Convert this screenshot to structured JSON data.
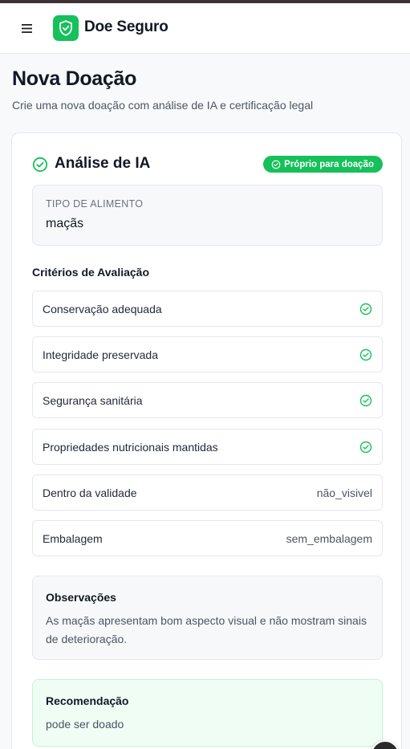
{
  "header": {
    "brand": "Doe Seguro",
    "menu_icon": "menu-icon",
    "logo_icon": "shield-check-icon"
  },
  "page": {
    "title": "Nova Doação",
    "subtitle": "Crie uma nova doação com análise de IA e certificação legal"
  },
  "analysis": {
    "title": "Análise de IA",
    "status_badge": "Próprio para doação",
    "food_type_label": "TIPO DE ALIMENTO",
    "food_type_value": "maçãs",
    "criteria_title": "Critérios de Avaliação",
    "criteria": [
      {
        "label": "Conservação adequada",
        "status": "check"
      },
      {
        "label": "Integridade preservada",
        "status": "check"
      },
      {
        "label": "Segurança sanitária",
        "status": "check"
      },
      {
        "label": "Propriedades nutricionais mantidas",
        "status": "check"
      },
      {
        "label": "Dentro da validade",
        "value": "não_visivel"
      },
      {
        "label": "Embalagem",
        "value": "sem_embalagem"
      }
    ],
    "observations": {
      "title": "Observações",
      "text": "As maçãs apresentam bom aspecto visual e não mostram sinais de deterioração."
    },
    "recommendation": {
      "title": "Recomendação",
      "text": "pode ser doado"
    }
  },
  "colors": {
    "accent": "#16c05a",
    "recommendation_bg": "#f0fdf4"
  }
}
